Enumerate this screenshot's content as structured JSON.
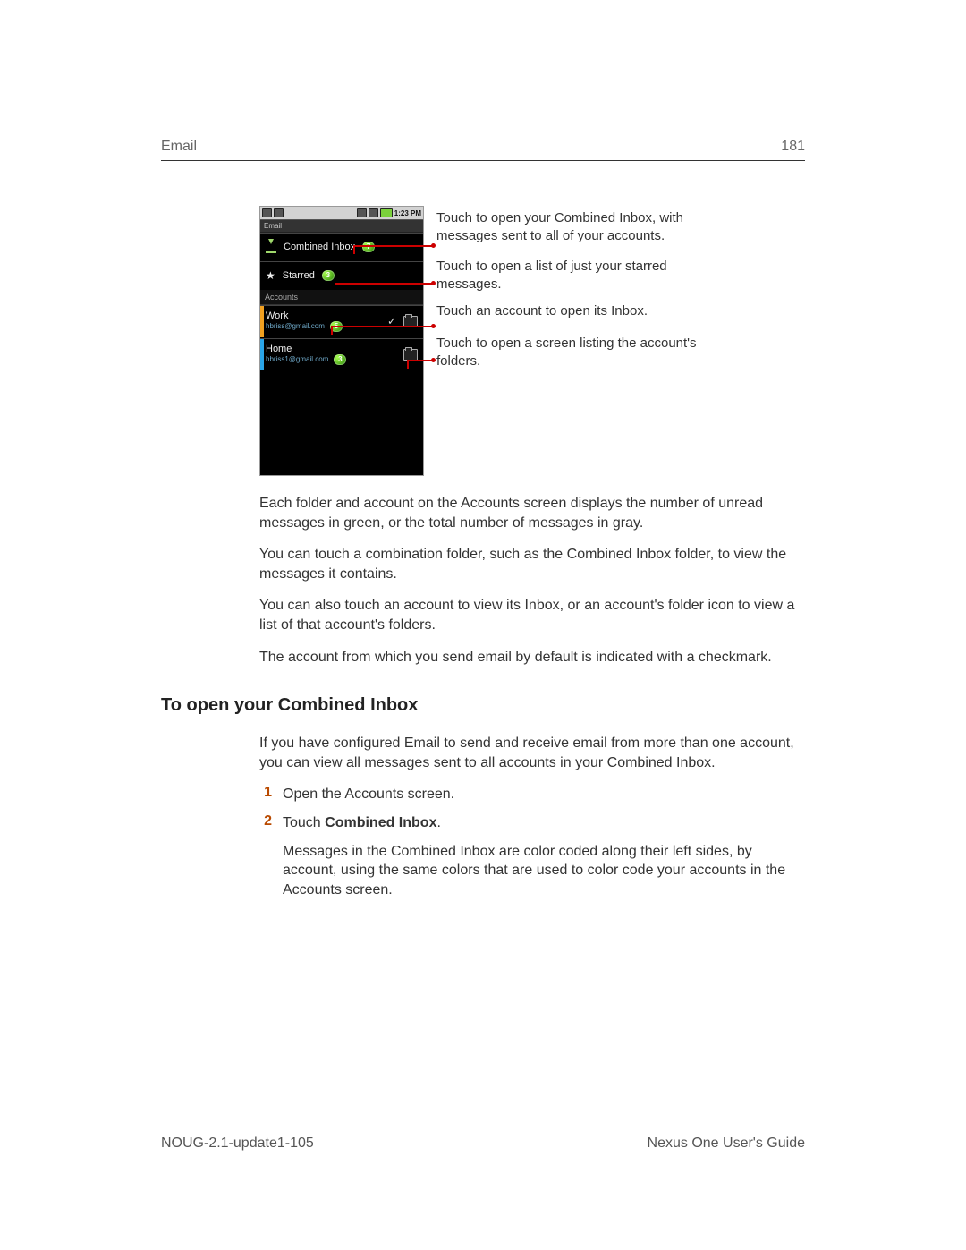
{
  "header": {
    "section": "Email",
    "page_number": "181"
  },
  "phone": {
    "status": {
      "time": "1:23 PM"
    },
    "title": "Email",
    "combined": {
      "label": "Combined Inbox",
      "badge": "7"
    },
    "starred": {
      "label": "Starred",
      "badge": "3"
    },
    "accounts_header": "Accounts",
    "work": {
      "name": "Work",
      "email": "hbriss@gmail.com",
      "badge": "5",
      "stripe": "#f0a020"
    },
    "home": {
      "name": "Home",
      "email": "hbriss1@gmail.com",
      "badge": "3",
      "stripe": "#2aa5e8"
    }
  },
  "callouts": {
    "combined": "Touch to open your Combined Inbox, with messages sent to all of your accounts.",
    "starred": "Touch to open a list of just your starred messages.",
    "account": "Touch an account to open its Inbox.",
    "folder": "Touch to open a screen listing the account's folders."
  },
  "paragraphs": {
    "p1": "Each folder and account on the Accounts screen displays the number of unread messages in green, or the total number of messages in gray.",
    "p2": "You can touch a combination folder, such as the Combined Inbox folder, to view the messages it contains.",
    "p3": "You can also touch an account to view its Inbox, or an account's folder icon to view a list of that account's folders.",
    "p4": "The account from which you send email by default is indicated with a checkmark."
  },
  "heading": "To open your Combined Inbox",
  "intro": "If you have configured Email to send and receive email from more than one account, you can view all messages sent to all accounts in your Combined Inbox.",
  "steps": {
    "s1_num": "1",
    "s1_text": "Open the Accounts screen.",
    "s2_num": "2",
    "s2_prefix": "Touch ",
    "s2_strong": "Combined Inbox",
    "s2_suffix": ".",
    "s2_body": "Messages in the Combined Inbox are color coded along their left sides, by account, using the same colors that are used to color code your accounts in the Accounts screen."
  },
  "footer": {
    "doc": "NOUG-2.1-update1-105",
    "guide": "Nexus One User's Guide"
  }
}
